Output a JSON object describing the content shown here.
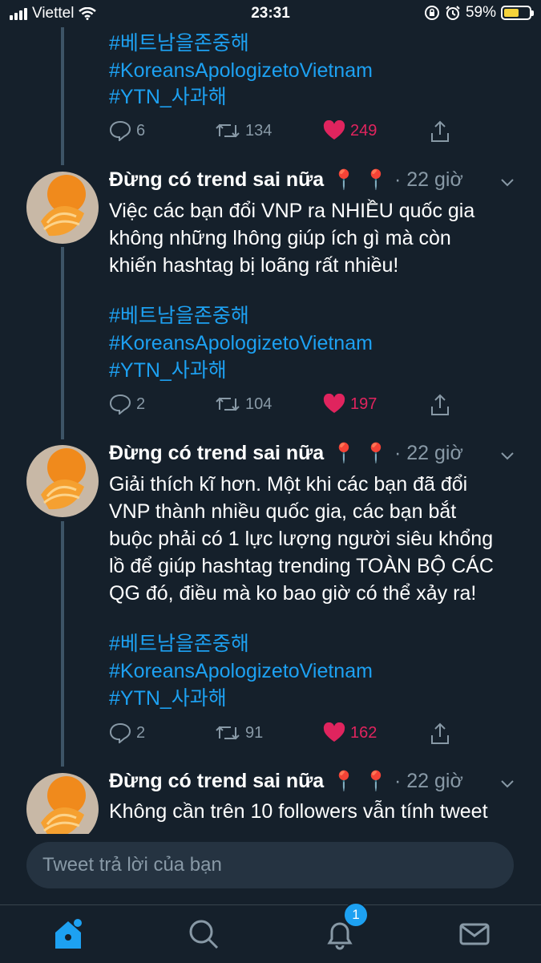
{
  "status_bar": {
    "carrier": "Viettel",
    "time": "23:31",
    "battery": "59%",
    "battery_level": 0.59
  },
  "tweets": [
    {
      "hashtags": [
        "#베트남을존중해",
        "#KoreansApologizetoVietnam",
        "#YTN_사과해"
      ],
      "replies": "6",
      "retweets": "134",
      "likes": "249"
    },
    {
      "author": "Đừng có trend sai nữa",
      "time": "· 22 giờ",
      "text_lines": [
        "Việc các bạn đổi VNP ra NHIỀU quốc gia",
        "không những lhông giúp ích gì mà còn",
        "khiến hashtag bị loãng rất nhiều!"
      ],
      "hashtags": [
        "#베트남을존중해",
        "#KoreansApologizetoVietnam",
        "#YTN_사과해"
      ],
      "replies": "2",
      "retweets": "104",
      "likes": "197"
    },
    {
      "author": "Đừng có trend sai nữa",
      "time": "· 22 giờ",
      "text_lines": [
        "Giải thích kĩ hơn. Một khi các bạn đã đổi",
        "VNP thành nhiều quốc gia, các bạn bắt",
        "buộc phải có 1 lực lượng người siêu khổng",
        "lồ để giúp hashtag trending TOÀN BỘ CÁC",
        "QG đó, điều mà ko bao giờ có thể xảy ra!"
      ],
      "hashtags": [
        "#베트남을존중해",
        "#KoreansApologizetoVietnam",
        "#YTN_사과해"
      ],
      "replies": "2",
      "retweets": "91",
      "likes": "162"
    },
    {
      "author": "Đừng có trend sai nữa",
      "time": "· 22 giờ",
      "text_lines": [
        "Không cần trên 10 followers vẫn tính tweet"
      ]
    }
  ],
  "reply": {
    "placeholder": "Tweet trả lời của bạn"
  },
  "tab_bar": {
    "notifications_badge": "1"
  },
  "colors": {
    "background": "#15202b",
    "link": "#1da1f2",
    "like": "#e0245e",
    "muted": "#8899a6"
  }
}
